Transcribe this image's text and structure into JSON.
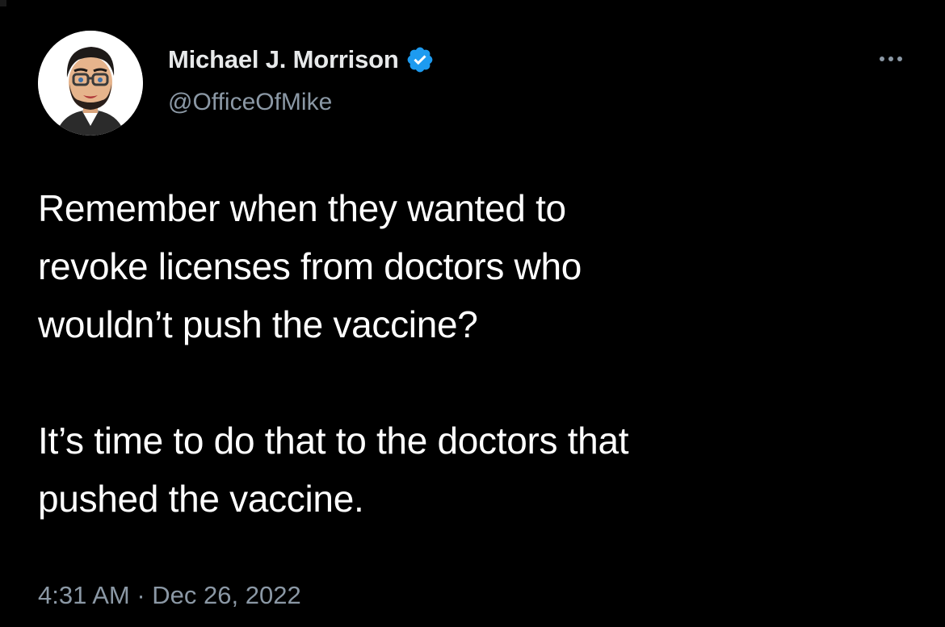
{
  "tweet": {
    "author": {
      "display_name": "Michael J. Morrison",
      "handle": "@OfficeOfMike",
      "verified": true,
      "avatar_icon": "bitmoji-avatar"
    },
    "text": [
      "Remember when they wanted to\nrevoke licenses from doctors who\nwouldn’t push the vaccine?",
      "It’s time to do that to the doctors that\npushed the vaccine."
    ],
    "timestamp": "4:31 AM · Dec 26, 2022",
    "more_icon": "more-horizontal-icon"
  },
  "colors": {
    "background": "#000000",
    "primary_text": "#ffffff",
    "secondary_text": "#8b98a5",
    "verified_badge": "#1d9bf0"
  }
}
